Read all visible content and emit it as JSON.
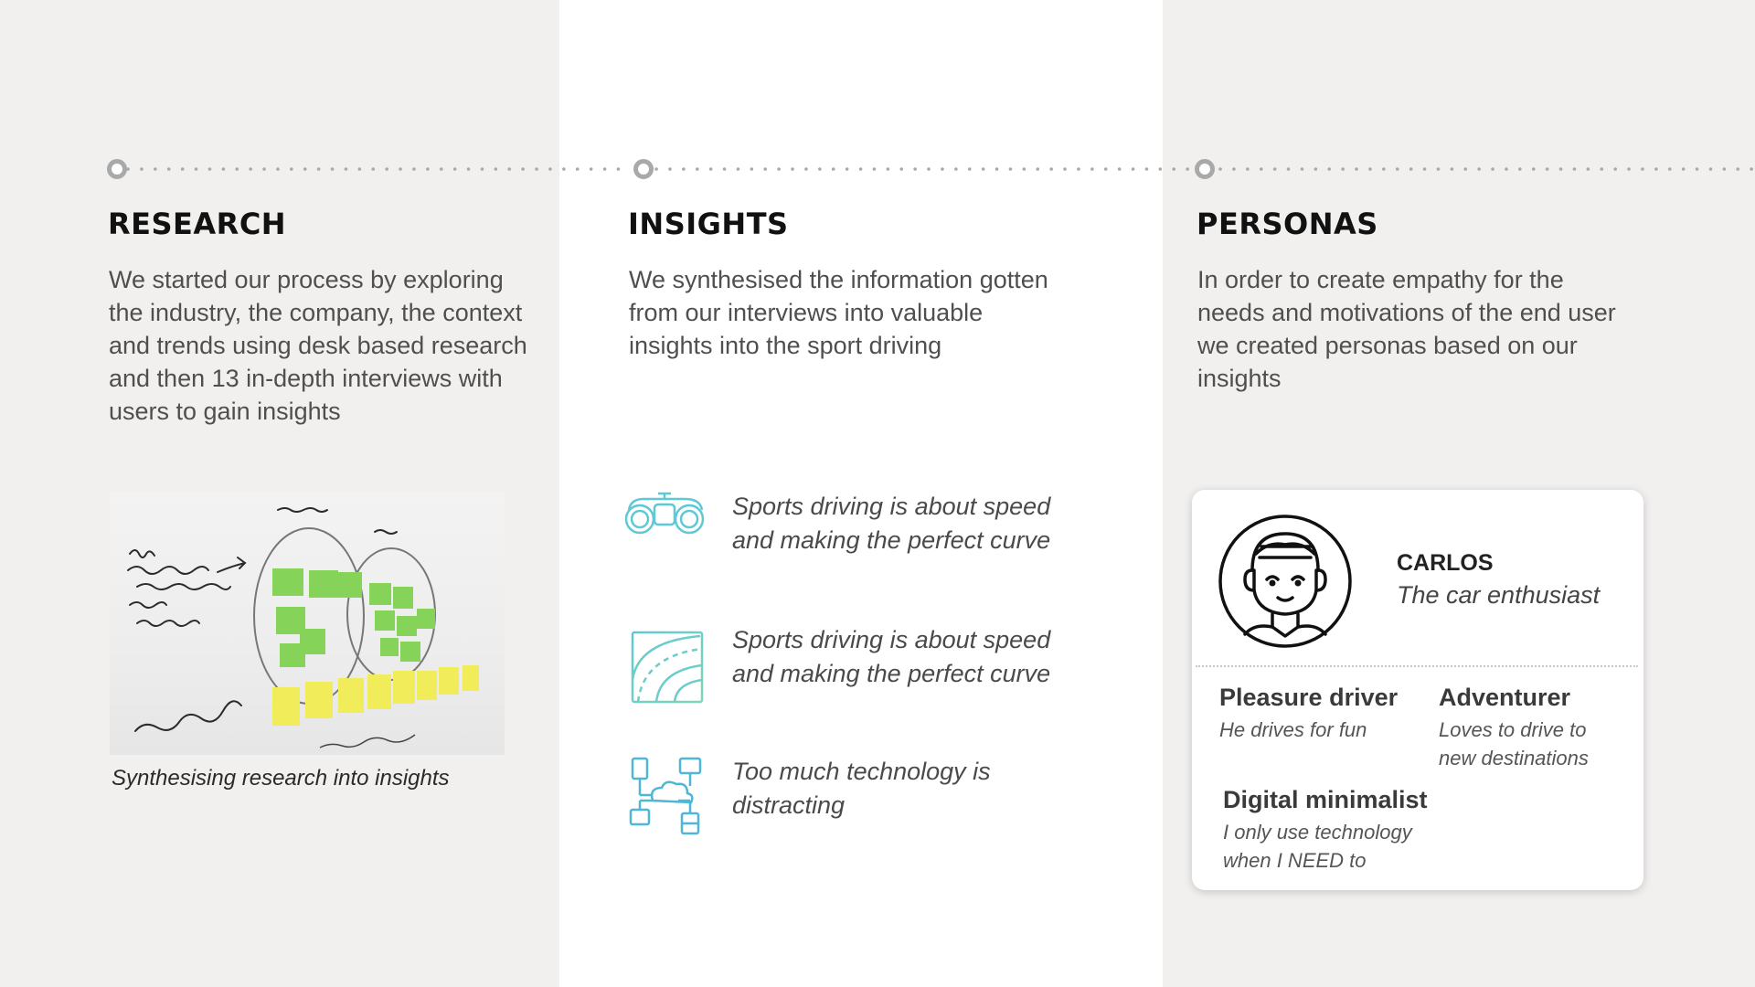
{
  "sections": {
    "research": {
      "title": "RESEARCH",
      "body": "We started our process by exploring the industry, the company, the context and trends using desk based research and then 13 in-depth interviews with users to gain insights",
      "image_caption": "Synthesising research into insights",
      "image_icon": "whiteboard-photo"
    },
    "insights": {
      "title": "INSIGHTS",
      "body": "We synthesised the information gotten from our interviews into valuable insights into the sport driving",
      "items": [
        {
          "icon": "binoculars-icon",
          "text": "Sports driving is about speed and making the perfect curve"
        },
        {
          "icon": "road-curve-icon",
          "text": "Sports driving is about speed and making the perfect curve"
        },
        {
          "icon": "cloud-network-icon",
          "text": "Too much technology is distracting"
        }
      ]
    },
    "personas": {
      "title": "PERSONAS",
      "body": "In order to create empathy for the needs and motivations of the end user we created personas based on our insights",
      "card": {
        "avatar_icon": "avatar-icon",
        "name": "CARLOS",
        "role": "The car enthusiast",
        "traits": [
          {
            "title": "Pleasure driver",
            "desc": "He drives for fun"
          },
          {
            "title": "Adventurer",
            "desc": "Loves to drive to new destinations"
          },
          {
            "title": "Digital minimalist",
            "desc": "I only use technology when I NEED to"
          }
        ]
      }
    }
  },
  "colors": {
    "background_gray": "#f1f0ef",
    "background_white": "#ffffff",
    "timeline_gray": "#a9a9a9",
    "icon_teal": "#5ec8d4",
    "icon_blue": "#4aa3dc"
  }
}
